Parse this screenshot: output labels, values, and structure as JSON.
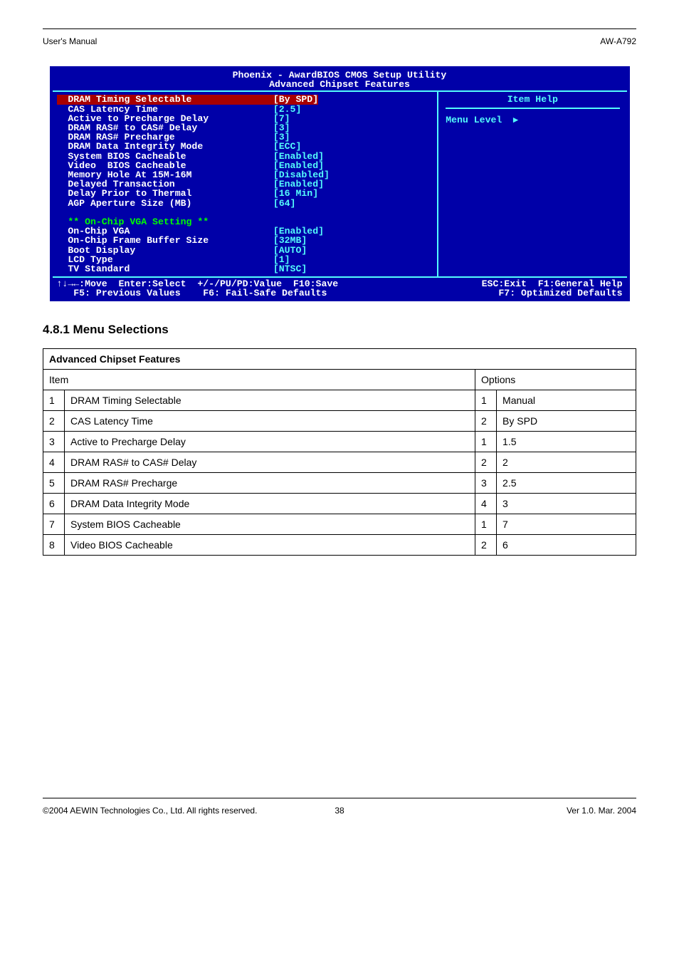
{
  "header": {
    "left": "User's Manual",
    "right": "AW-A792"
  },
  "bios": {
    "title1": "Phoenix - AwardBIOS CMOS Setup Utility",
    "title2": "Advanced Chipset Features",
    "items": [
      {
        "label": "DRAM Timing Selectable",
        "value": "[By SPD]",
        "sel": true
      },
      {
        "label": "CAS Latency Time",
        "value": "[2.5]"
      },
      {
        "label": "Active to Precharge Delay",
        "value": "[7]"
      },
      {
        "label": "DRAM RAS# to CAS# Delay",
        "value": "[3]"
      },
      {
        "label": "DRAM RAS# Precharge",
        "value": "[3]"
      },
      {
        "label": "DRAM Data Integrity Mode",
        "value": "[ECC]"
      },
      {
        "label": "System BIOS Cacheable",
        "value": "[Enabled]"
      },
      {
        "label": "Video  BIOS Cacheable",
        "value": "[Enabled]"
      },
      {
        "label": "Memory Hole At 15M-16M",
        "value": "[Disabled]"
      },
      {
        "label": "Delayed Transaction",
        "value": "[Enabled]"
      },
      {
        "label": "Delay Prior to Thermal",
        "value": "[16 Min]"
      },
      {
        "label": "AGP Aperture Size (MB)",
        "value": "[64]"
      }
    ],
    "section": "** On-Chip VGA Setting **",
    "items2": [
      {
        "label": "On-Chip VGA",
        "value": "[Enabled]"
      },
      {
        "label": "On-Chip Frame Buffer Size",
        "value": "[32MB]"
      },
      {
        "label": "Boot Display",
        "value": "[AUTO]"
      },
      {
        "label": "LCD Type",
        "value": "[1]"
      },
      {
        "label": "TV Standard",
        "value": "[NTSC]"
      }
    ],
    "right": {
      "title": "Item Help",
      "menu": "Menu Level",
      "arrow": "▸"
    },
    "footer1": {
      "l": "↑↓→←:Move  Enter:Select  +/-/PU/PD:Value  F10:Save",
      "r": "ESC:Exit  F1:General Help"
    },
    "footer2": {
      "l": "F5: Previous Values    F6: Fail-Safe Defaults",
      "r": "F7: Optimized Defaults"
    }
  },
  "section_heading": "4.8.1 Menu Selections",
  "table": {
    "group": "Advanced Chipset Features",
    "head_item": "Item",
    "head_opt": "Options",
    "rows": [
      {
        "n": "1",
        "item": "DRAM Timing Selectable",
        "o": "1",
        "opt": "Manual"
      },
      {
        "n": "2",
        "item": "CAS Latency Time",
        "o": "2",
        "opt": "By SPD"
      },
      {
        "n": "3",
        "item": "Active to Precharge Delay",
        "o": "1",
        "opt": "1.5"
      },
      {
        "n": "4",
        "item": "DRAM RAS# to CAS# Delay",
        "o": "2",
        "opt": "2"
      },
      {
        "n": "5",
        "item": "DRAM RAS# Precharge",
        "o": "3",
        "opt": "2.5"
      },
      {
        "n": "6",
        "item": "DRAM Data Integrity Mode",
        "o": "4",
        "opt": "3"
      },
      {
        "n": "7",
        "item": "System BIOS Cacheable",
        "o": "1",
        "opt": "7"
      },
      {
        "n": "8",
        "item": "Video BIOS Cacheable",
        "o": "2",
        "opt": "6"
      }
    ]
  },
  "footer": {
    "left": "©2004 AEWIN Technologies Co., Ltd.  All rights reserved.",
    "right": "Ver 1.0. Mar. 2004",
    "page": "38"
  }
}
